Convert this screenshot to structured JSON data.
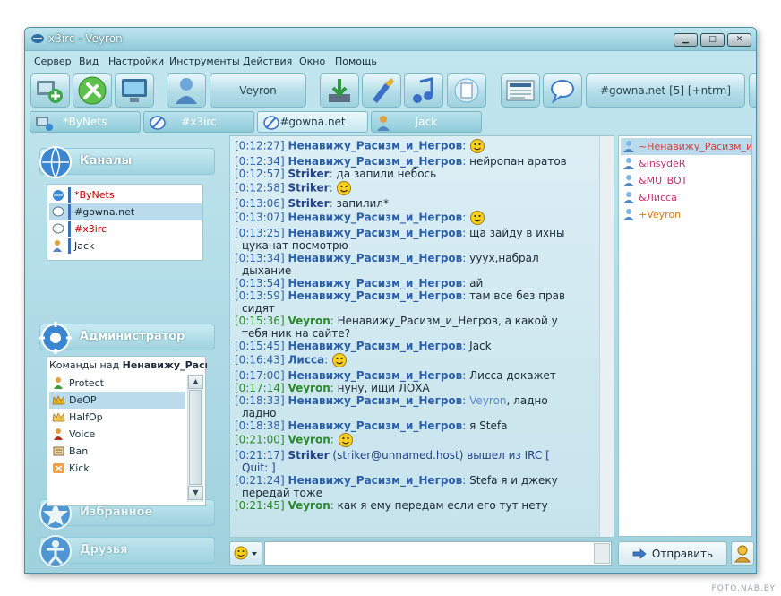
{
  "window": {
    "title": "x3irc - Veyron"
  },
  "window_controls": {
    "minimize": "▁",
    "maximize": "□",
    "close": "✕"
  },
  "menu": [
    "Сервер",
    "Вид",
    "Настройки",
    "Инструменты",
    "Действия",
    "Окно",
    "Помощь"
  ],
  "toolbar": {
    "nick_label": "Veyron",
    "channel_label": "#gowna.net [5] [+ntrm]",
    "icons": [
      "add-server-icon",
      "tools-icon",
      "monitor-icon",
      "user-icon",
      "download-icon",
      "brush-icon",
      "music-note-icon",
      "document-icon",
      "news-icon",
      "speech-bubble-icon"
    ]
  },
  "tabs": [
    {
      "label": "*ByNets",
      "icon": "network-icon"
    },
    {
      "label": "#x3irc",
      "icon": "channel-icon"
    },
    {
      "label": "#gowna.net",
      "icon": "channel-icon",
      "active": true
    },
    {
      "label": "Jack",
      "icon": "user-icon"
    }
  ],
  "left": {
    "channels_header": "Каналы",
    "channels": [
      {
        "label": "*ByNets",
        "color": "#cc0000",
        "icon": "network-icon"
      },
      {
        "label": "#gowna.net",
        "color": "#1a2a35",
        "icon": "channel-icon",
        "selected": true
      },
      {
        "label": "#x3irc",
        "color": "#cc0000",
        "icon": "channel-icon"
      },
      {
        "label": "Jack",
        "color": "#1a2a35",
        "icon": "user-icon"
      }
    ],
    "admin_header": "Администратор",
    "admin_prefix": "Команды над",
    "admin_target": "Ненавижу_Расизм_и_Негров",
    "commands": [
      {
        "label": "Protect",
        "icon": "protect-icon"
      },
      {
        "label": "DeOP",
        "icon": "crown-icon",
        "selected": true
      },
      {
        "label": "HalfOp",
        "icon": "halfop-icon"
      },
      {
        "label": "Voice",
        "icon": "voice-icon"
      },
      {
        "label": "Ban",
        "icon": "ban-icon"
      },
      {
        "label": "Kick",
        "icon": "kick-icon"
      }
    ],
    "favorites_header": "Избранное",
    "friends_header": "Друзья"
  },
  "chat": [
    {
      "ts": "[0:12:27]",
      "nick": "Ненавижу_Расизм_и_Негров",
      "sep": ":",
      "text": "",
      "smile": true
    },
    {
      "ts": "[0:12:34]",
      "nick": "Ненавижу_Расизм_и_Негров",
      "sep": ":",
      "text": "нейропан аратов"
    },
    {
      "ts": "[0:12:57]",
      "nick": "Striker",
      "sep": ":",
      "text": "да запили небось"
    },
    {
      "ts": "[0:12:58]",
      "nick": "Striker",
      "sep": ":",
      "text": "",
      "smile": true
    },
    {
      "ts": "[0:13:06]",
      "nick": "Striker",
      "sep": ":",
      "text": "запилил*"
    },
    {
      "ts": "[0:13:07]",
      "nick": "Ненавижу_Расизм_и_Негров",
      "sep": ":",
      "text": "",
      "smile": true
    },
    {
      "ts": "[0:13:25]",
      "nick": "Ненавижу_Расизм_и_Негров",
      "sep": ":",
      "text": "ща зайду в ихны",
      "cont": "цуканат посмотрю"
    },
    {
      "ts": "[0:13:34]",
      "nick": "Ненавижу_Расизм_и_Негров",
      "sep": ":",
      "text": "уууx,набрал",
      "cont": "дыхание"
    },
    {
      "ts": "[0:13:54]",
      "nick": "Ненавижу_Расизм_и_Негров",
      "sep": ":",
      "text": "ай"
    },
    {
      "ts": "[0:13:59]",
      "nick": "Ненавижу_Расизм_и_Негров",
      "sep": ":",
      "text": "там все без прав",
      "cont": "сидят"
    },
    {
      "ts": "[0:15:36]",
      "nick": "Veyron",
      "sep": ":",
      "text": "Ненавижу_Расизм_и_Негров, а какой у",
      "cont": "тебя ник на сайте?",
      "me": true
    },
    {
      "ts": "[0:15:45]",
      "nick": "Ненавижу_Расизм_и_Негров",
      "sep": ":",
      "text": "Jack"
    },
    {
      "ts": "[0:16:43]",
      "nick": "Лисса",
      "sep": ":",
      "text": "",
      "smile": true
    },
    {
      "ts": "[0:17:00]",
      "nick": "Ненавижу_Расизм_и_Негров",
      "sep": ":",
      "text": "Лисса докажет"
    },
    {
      "ts": "[0:17:14]",
      "nick": "Veyron",
      "sep": ":",
      "text": "нуну, ищи ЛОХА",
      "me": true
    },
    {
      "ts": "[0:18:33]",
      "nick": "Ненавижу_Расизм_и_Негров",
      "sep": ":",
      "pre": "Veyron",
      "text": ", ладно",
      "cont": "ладно"
    },
    {
      "ts": "[0:18:38]",
      "nick": "Ненавижу_Расизм_и_Негров",
      "sep": ":",
      "text": "я Stefa"
    },
    {
      "ts": "[0:21:00]",
      "nick": "Veyron",
      "sep": ":",
      "text": "",
      "smile": true,
      "me": true
    },
    {
      "ts": "[0:21:17]",
      "nick": "Striker",
      "sep": "",
      "text": "(striker@unnamed.host) вышел из IRC [",
      "cont": "Quit:  ]",
      "system": true
    },
    {
      "ts": "[0:21:24]",
      "nick": "Ненавижу_Расизм_и_Негров",
      "sep": ":",
      "text": "Stefa я и джеку",
      "cont": "передай тоже"
    },
    {
      "ts": "[0:21:45]",
      "nick": "Veyron",
      "sep": ":",
      "text": "как я ему передам если его тут нету",
      "me": true
    }
  ],
  "users": [
    {
      "label": "~Ненавижу_Расизм_и_Негров",
      "color": "#d24040",
      "selected": true
    },
    {
      "label": "&InsydeR",
      "color": "#c4306a"
    },
    {
      "label": "&MU_BOT",
      "color": "#c4306a"
    },
    {
      "label": "&Лисса",
      "color": "#c4306a"
    },
    {
      "label": "+Veyron",
      "color": "#d87a10"
    }
  ],
  "input": {
    "value": "",
    "placeholder": ""
  },
  "send_label": "Отправить",
  "watermark": "FOTO.NAB.BY"
}
